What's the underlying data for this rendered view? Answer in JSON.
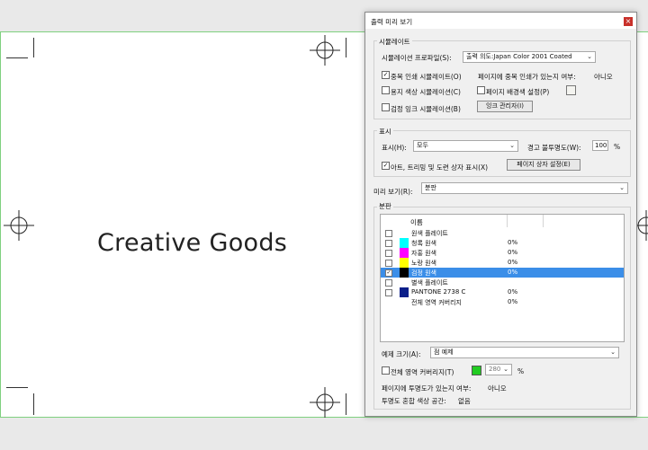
{
  "page": {
    "text": "Creative Goods"
  },
  "dialog": {
    "title": "출력 미리 보기",
    "close_label": "×",
    "simulation": {
      "group_label": "시뮬레이트",
      "profile_label": "시뮬레이션 프로파일(S):",
      "profile_value": "출력 의도:Japan Color 2001 Coated",
      "overprint_label": "중복 인쇄 시뮬레이트(O)",
      "overprint_checked": "✓",
      "page_overprint_label": "페이지에 중복 인쇄가 있는지 여부:",
      "page_overprint_value": "아니오",
      "paper_color_label": "용지 색상 시뮬레이션(C)",
      "page_bg_label": "페이지 배경색 설정(P)",
      "black_ink_label": "검정 잉크 시뮬레이션(B)",
      "ink_manager_button": "잉크 관리자(I)"
    },
    "display": {
      "group_label": "표시",
      "show_label": "표시(H):",
      "show_value": "모두",
      "warning_label": "경고 불투명도(W):",
      "warning_value": "100",
      "warning_unit": "%",
      "art_trim_label": "아트, 트리밍 및 도련 상자 표시(X)",
      "art_trim_checked": "✓",
      "page_box_button": "페이지 상자 설정(E)"
    },
    "preview": {
      "label": "미리 보기(R):",
      "value": "분판"
    },
    "separations": {
      "group_label": "분판",
      "column_name": "이름",
      "rows": [
        {
          "name": "원색 플레이트",
          "pct": "",
          "checked": "",
          "color": ""
        },
        {
          "name": "청록 원색",
          "pct": "0%",
          "checked": "",
          "color": "#00ffff"
        },
        {
          "name": "자홍 원색",
          "pct": "0%",
          "checked": "",
          "color": "#ff00ff"
        },
        {
          "name": "노랑 원색",
          "pct": "0%",
          "checked": "",
          "color": "#ffff00"
        },
        {
          "name": "검정 원색",
          "pct": "0%",
          "checked": "✓",
          "color": "#000000"
        },
        {
          "name": "별색 플레이트",
          "pct": "",
          "checked": "",
          "color": ""
        },
        {
          "name": "PANTONE 2738 C",
          "pct": "0%",
          "checked": "",
          "color": "#0b1f8a"
        },
        {
          "name": "전체 영역 커버리지",
          "pct": "0%",
          "checked": "",
          "color": ""
        }
      ]
    },
    "sample": {
      "label": "예제 크기(A):",
      "value": "점 예제"
    },
    "coverage": {
      "label": "전체 영역 커버리지(T)",
      "value": "280",
      "unit": "%",
      "swatch_color": "#22cc22"
    },
    "info": {
      "transparency_label": "페이지에 투명도가 있는지 여부:",
      "transparency_value": "아니오",
      "blend_label": "투명도 혼합 색상 공간:",
      "blend_value": "없음"
    }
  }
}
